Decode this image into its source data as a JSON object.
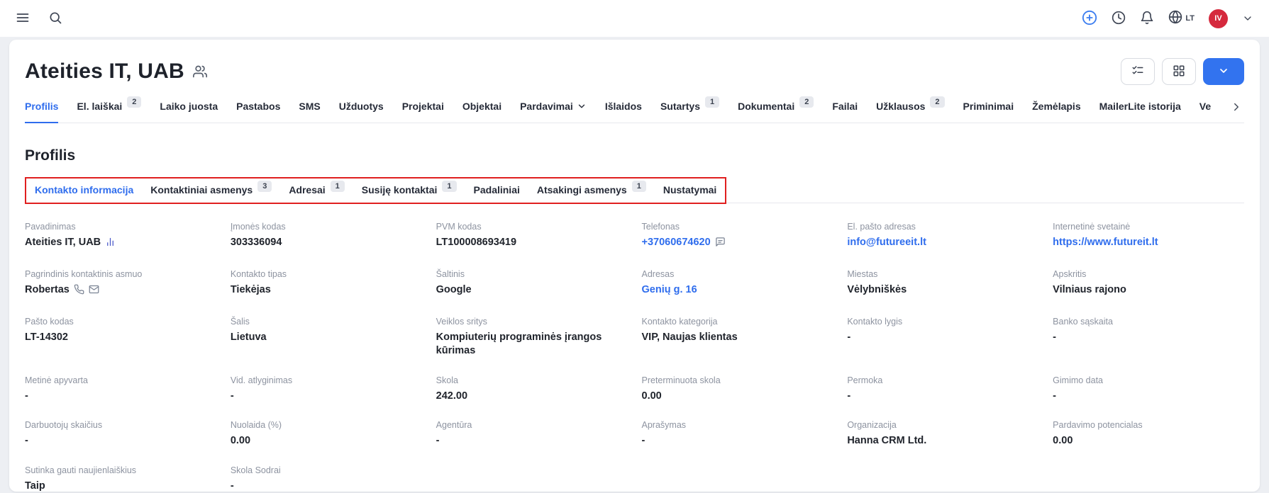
{
  "topbar": {
    "language": "LT",
    "avatar_initials": "IV"
  },
  "header": {
    "title": "Ateities IT, UAB"
  },
  "tabs": [
    {
      "label": "Profilis",
      "active": true
    },
    {
      "label": "El. laiškai",
      "badge": "2"
    },
    {
      "label": "Laiko juosta"
    },
    {
      "label": "Pastabos"
    },
    {
      "label": "SMS"
    },
    {
      "label": "Užduotys"
    },
    {
      "label": "Projektai"
    },
    {
      "label": "Objektai"
    },
    {
      "label": "Pardavimai",
      "dropdown": true
    },
    {
      "label": "Išlaidos"
    },
    {
      "label": "Sutartys",
      "badge": "1"
    },
    {
      "label": "Dokumentai",
      "badge": "2"
    },
    {
      "label": "Failai"
    },
    {
      "label": "Užklausos",
      "badge": "2"
    },
    {
      "label": "Priminimai"
    },
    {
      "label": "Žemėlapis"
    },
    {
      "label": "MailerLite istorija"
    },
    {
      "label": "Ve"
    }
  ],
  "section": {
    "title": "Profilis"
  },
  "subtabs": [
    {
      "label": "Kontakto informacija",
      "active": true
    },
    {
      "label": "Kontaktiniai asmenys",
      "badge": "3"
    },
    {
      "label": "Adresai",
      "badge": "1"
    },
    {
      "label": "Susiję kontaktai",
      "badge": "1"
    },
    {
      "label": "Padaliniai"
    },
    {
      "label": "Atsakingi asmenys",
      "badge": "1"
    },
    {
      "label": "Nustatymai"
    }
  ],
  "fields": [
    {
      "label": "Pavadinimas",
      "value": "Ateities IT, UAB",
      "icons": [
        "bar-chart-icon"
      ]
    },
    {
      "label": "Įmonės kodas",
      "value": "303336094"
    },
    {
      "label": "PVM kodas",
      "value": "LT100008693419"
    },
    {
      "label": "Telefonas",
      "value": "+37060674620",
      "link": true,
      "icons": [
        "chat-icon"
      ]
    },
    {
      "label": "El. pašto adresas",
      "value": "info@futureeit.lt",
      "link": true
    },
    {
      "label": "Internetinė svetainė",
      "value": "https://www.futureit.lt",
      "link": true
    },
    {
      "label": "Pagrindinis kontaktinis asmuo",
      "value": "Robertas",
      "icons": [
        "phone-icon",
        "mail-icon"
      ]
    },
    {
      "label": "Kontakto tipas",
      "value": "Tiekėjas"
    },
    {
      "label": "Šaltinis",
      "value": "Google"
    },
    {
      "label": "Adresas",
      "value": "Genių g. 16",
      "link": true
    },
    {
      "label": "Miestas",
      "value": "Vėlybniškės"
    },
    {
      "label": "Apskritis",
      "value": "Vilniaus rajono"
    },
    {
      "label": "Pašto kodas",
      "value": "LT-14302"
    },
    {
      "label": "Šalis",
      "value": "Lietuva"
    },
    {
      "label": "Veiklos sritys",
      "value": "Kompiuterių programinės įrangos kūrimas"
    },
    {
      "label": "Kontakto kategorija",
      "value": "VIP, Naujas klientas"
    },
    {
      "label": "Kontakto lygis",
      "value": "-"
    },
    {
      "label": "Banko sąskaita",
      "value": "-"
    },
    {
      "label": "Metinė apyvarta",
      "value": "-"
    },
    {
      "label": "Vid. atlyginimas",
      "value": "-"
    },
    {
      "label": "Skola",
      "value": "242.00"
    },
    {
      "label": "Preterminuota skola",
      "value": "0.00"
    },
    {
      "label": "Permoka",
      "value": "-"
    },
    {
      "label": "Gimimo data",
      "value": "-"
    },
    {
      "label": "Darbuotojų skaičius",
      "value": "-"
    },
    {
      "label": "Nuolaida (%)",
      "value": "0.00"
    },
    {
      "label": "Agentūra",
      "value": "-"
    },
    {
      "label": "Aprašymas",
      "value": "-"
    },
    {
      "label": "Organizacija",
      "value": "Hanna CRM Ltd."
    },
    {
      "label": "Pardavimo potencialas",
      "value": "0.00"
    },
    {
      "label": "Sutinka gauti naujienlaiškius",
      "value": "Taip"
    },
    {
      "label": "Skola Sodrai",
      "value": "-"
    }
  ],
  "colors": {
    "accent": "#2f6ded",
    "link": "#2f6ded",
    "annotation_box": "#e01f1f",
    "avatar_bg": "#d5293d"
  }
}
